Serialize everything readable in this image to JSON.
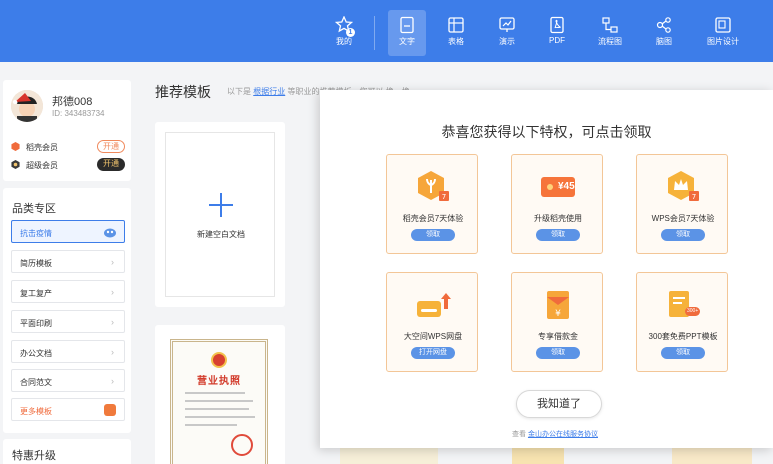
{
  "nav": {
    "items": [
      {
        "label": "我的",
        "icon": "star-user-icon",
        "badge": "1"
      },
      {
        "label": "文字",
        "icon": "document-icon",
        "active": true
      },
      {
        "label": "表格",
        "icon": "table-icon"
      },
      {
        "label": "演示",
        "icon": "presentation-icon"
      },
      {
        "label": "PDF",
        "icon": "pdf-icon"
      },
      {
        "label": "流程图",
        "icon": "flowchart-icon"
      },
      {
        "label": "脑图",
        "icon": "mindmap-icon"
      },
      {
        "label": "图片设计",
        "icon": "image-design-icon"
      }
    ]
  },
  "user": {
    "name": "邦德008",
    "id": "ID: 343483734",
    "memberships": [
      {
        "label": "稻壳会员",
        "button": "开通",
        "color": "#f08a5d"
      },
      {
        "label": "超级会员",
        "button": "开通",
        "color": "#2b2b2b"
      }
    ]
  },
  "categories": {
    "title": "品类专区",
    "items": [
      "抗击疫情",
      "简历模板",
      "复工复产",
      "平面印刷",
      "办公文档",
      "合同范文",
      "更多模板"
    ]
  },
  "promo": {
    "title": "特惠升级"
  },
  "main": {
    "title": "推荐模板",
    "subtitle_prefix": "以下是",
    "subtitle_link": "根据行业",
    "subtitle_suffix": "等职业的推荐模板，您可以",
    "refresh": "换一换",
    "new_blank": "新建空白文档",
    "license_title": "营业执照"
  },
  "modal": {
    "title": "恭喜您获得以下特权，可点击领取",
    "perks": [
      {
        "label": "稻壳会员7天体验",
        "button": "领取",
        "icon": "wheat-hexagon-icon"
      },
      {
        "label": "升级稻壳使用",
        "button": "领取",
        "icon": "coupon-icon",
        "coupon_value": "¥45"
      },
      {
        "label": "WPS会员7天体验",
        "button": "领取",
        "icon": "crown-hexagon-icon"
      },
      {
        "label": "大空间WPS网盘",
        "button": "打开网盘",
        "icon": "cloud-drive-icon"
      },
      {
        "label": "专享借款金",
        "button": "领取",
        "icon": "red-envelope-icon"
      },
      {
        "label": "300套免费PPT模板",
        "button": "领取",
        "icon": "ppt-templates-icon",
        "badge": "300+"
      }
    ],
    "ok_button": "我知道了",
    "footer_prefix": "查看",
    "footer_link": "金山办公在线服务协议"
  },
  "colors": {
    "brand_blue": "#3d7de9",
    "perk_border": "#f3c697",
    "accent_orange": "#f08a5d"
  }
}
